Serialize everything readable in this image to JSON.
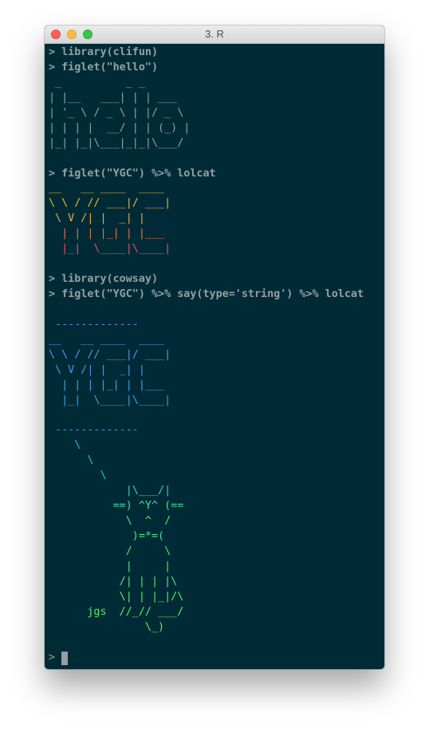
{
  "window": {
    "title": "3. R"
  },
  "terminal": {
    "prompt": "> ",
    "lines": [
      {
        "text": "> library(clifun)",
        "type": "cmd"
      },
      {
        "text": "> figlet(\"hello\")",
        "type": "cmd"
      },
      {
        "text": " _          _ _       ",
        "color": "#93a1a1"
      },
      {
        "text": "| |__   ___| | | ___  ",
        "color": "#93a1a1"
      },
      {
        "text": "| '_ \\ / _ \\ | |/ _ \\ ",
        "color": "#93a1a1"
      },
      {
        "text": "| | | |  __/ | | (_) |",
        "color": "#93a1a1"
      },
      {
        "text": "|_| |_|\\___|_|_|\\___/ ",
        "color": "#93a1a1"
      },
      {
        "text": "",
        "color": "#93a1a1"
      },
      {
        "text": "> figlet(\"YGC\") %>% lolcat",
        "type": "cmd"
      },
      {
        "text": "__   __ ____  ____ ",
        "color": "#f0a030"
      },
      {
        "text": "\\ \\ / // ___|/ ___|",
        "color": "#e8b43a"
      },
      {
        "text": " \\ V /| |  _| |    ",
        "color": "#f0a838"
      },
      {
        "text": "  | | | |_| | |___ ",
        "color": "#ee7040"
      },
      {
        "text": "  |_|  \\____|\\____|",
        "color": "#e8505a"
      },
      {
        "text": "",
        "color": "#93a1a1"
      },
      {
        "text": "> library(cowsay)",
        "type": "cmd"
      },
      {
        "text": "> figlet(\"YGC\") %>% say(type='string') %>% lolcat",
        "type": "cmd"
      },
      {
        "text": "",
        "color": "#93a1a1"
      },
      {
        "text": " -------------",
        "color": "#8a70ee"
      },
      {
        "text": "__   __ ____  ____ ",
        "color": "#6e8cf4"
      },
      {
        "text": "\\ \\ / // ___|/ ___|",
        "color": "#5a92f2"
      },
      {
        "text": " \\ V /| |  _| |    ",
        "color": "#5a8ef6"
      },
      {
        "text": "  | | | |_| | |___ ",
        "color": "#3ea4f0"
      },
      {
        "text": "  |_|  \\____|\\____|",
        "color": "#2aa4ee"
      },
      {
        "text": "",
        "color": "#93a1a1"
      },
      {
        "text": " -------------",
        "color": "#2a9ae8"
      },
      {
        "text": "    \\",
        "color": "#30aee0"
      },
      {
        "text": "      \\",
        "color": "#30b6dc"
      },
      {
        "text": "        \\",
        "color": "#34c2d4"
      },
      {
        "text": "            |\\___/|",
        "color": "#34d2c0"
      },
      {
        "text": "          ==) ^Y^ (==",
        "color": "#3ee0a4"
      },
      {
        "text": "            \\  ^  /",
        "color": "#40e29a"
      },
      {
        "text": "             )=*=(",
        "color": "#44e48e"
      },
      {
        "text": "            /     \\",
        "color": "#48e682"
      },
      {
        "text": "            |     |",
        "color": "#4ce878"
      },
      {
        "text": "           /| | | |\\",
        "color": "#50ea70"
      },
      {
        "text": "           \\| | |_|/\\",
        "color": "#54ec68"
      },
      {
        "text": "      jgs  //_// ___/",
        "color": "#58ee5e"
      },
      {
        "text": "               \\_)",
        "color": "#5cf056"
      },
      {
        "text": "",
        "color": "#93a1a1"
      },
      {
        "text": "> ",
        "type": "prompt",
        "cursor": true
      }
    ]
  },
  "colors": {
    "background": "#002b36",
    "foreground": "#93a1a1",
    "cursor": "#93a1a1"
  }
}
